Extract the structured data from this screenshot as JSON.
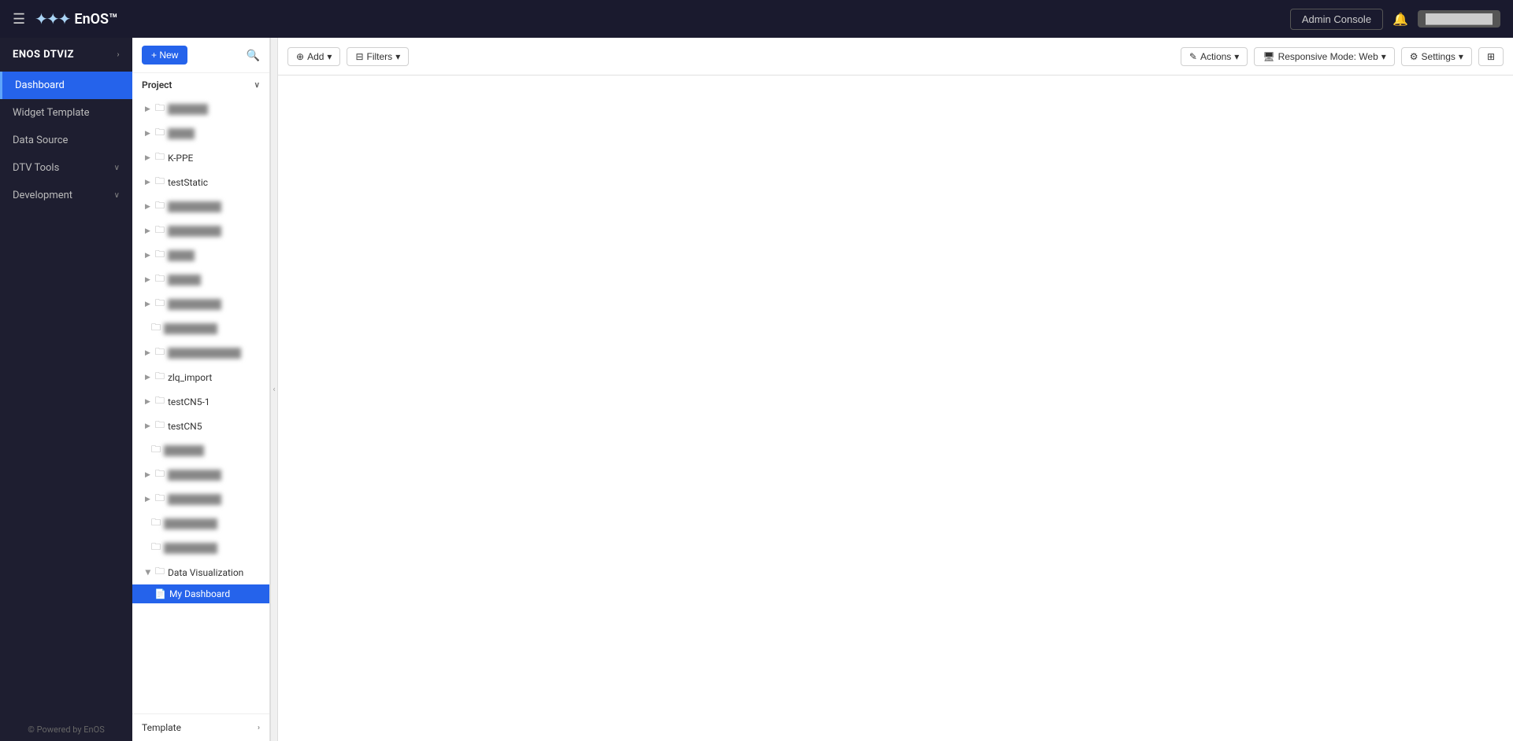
{
  "topnav": {
    "hamburger_icon": "☰",
    "logo_dots": "···",
    "logo_text": "EnOS™",
    "admin_console_label": "Admin Console",
    "notification_icon": "🔔",
    "user_label": "██████████"
  },
  "sidebar": {
    "brand_label": "ENOS DTVIZ",
    "items": [
      {
        "id": "dashboard",
        "label": "Dashboard",
        "active": true,
        "has_chevron": false
      },
      {
        "id": "widget-template",
        "label": "Widget Template",
        "active": false,
        "has_chevron": false
      },
      {
        "id": "data-source",
        "label": "Data Source",
        "active": false,
        "has_chevron": false
      },
      {
        "id": "dtv-tools",
        "label": "DTV Tools",
        "active": false,
        "has_chevron": true
      },
      {
        "id": "development",
        "label": "Development",
        "active": false,
        "has_chevron": true
      }
    ],
    "powered_by": "© Powered by EnOS"
  },
  "tree": {
    "new_btn_label": "+ New",
    "section_label": "Project",
    "items": [
      {
        "id": "item-1",
        "label": "██████",
        "expandable": true,
        "blurred": true,
        "indent": 0
      },
      {
        "id": "item-2",
        "label": "████",
        "expandable": true,
        "blurred": true,
        "indent": 0
      },
      {
        "id": "item-kppe",
        "label": "K-PPE",
        "expandable": true,
        "blurred": false,
        "indent": 0
      },
      {
        "id": "item-teststatic",
        "label": "testStatic",
        "expandable": true,
        "blurred": false,
        "indent": 0
      },
      {
        "id": "item-5",
        "label": "████████",
        "expandable": true,
        "blurred": true,
        "indent": 0
      },
      {
        "id": "item-6",
        "label": "████████",
        "expandable": true,
        "blurred": true,
        "indent": 0
      },
      {
        "id": "item-7",
        "label": "████",
        "expandable": true,
        "blurred": true,
        "indent": 0
      },
      {
        "id": "item-8",
        "label": "█████",
        "expandable": true,
        "blurred": true,
        "indent": 0
      },
      {
        "id": "item-9",
        "label": "████████",
        "expandable": true,
        "blurred": true,
        "indent": 0
      },
      {
        "id": "item-10",
        "label": "████████",
        "expandable": false,
        "blurred": true,
        "indent": 0
      },
      {
        "id": "item-11",
        "label": "███████████",
        "expandable": true,
        "blurred": true,
        "indent": 0
      },
      {
        "id": "item-zlq",
        "label": "zlq_import",
        "expandable": true,
        "blurred": false,
        "indent": 0
      },
      {
        "id": "item-testcn51",
        "label": "testCN5-1",
        "expandable": true,
        "blurred": false,
        "indent": 0
      },
      {
        "id": "item-testcn5",
        "label": "testCN5",
        "expandable": true,
        "blurred": false,
        "indent": 0
      },
      {
        "id": "item-12",
        "label": "██████",
        "expandable": false,
        "blurred": true,
        "indent": 0
      },
      {
        "id": "item-13",
        "label": "████████",
        "expandable": true,
        "blurred": true,
        "indent": 0
      },
      {
        "id": "item-14",
        "label": "████████",
        "expandable": true,
        "blurred": true,
        "indent": 0
      },
      {
        "id": "item-15",
        "label": "████████",
        "expandable": false,
        "blurred": true,
        "indent": 0
      },
      {
        "id": "item-16",
        "label": "████████",
        "expandable": false,
        "blurred": true,
        "indent": 0
      },
      {
        "id": "item-datavis",
        "label": "Data Visualization",
        "expandable": true,
        "expanded": true,
        "blurred": false,
        "indent": 0
      },
      {
        "id": "item-mydash",
        "label": "My Dashboard",
        "expandable": false,
        "blurred": false,
        "indent": 1,
        "active": true,
        "is_file": true
      }
    ],
    "footer_label": "Template"
  },
  "toolbar": {
    "add_label": "Add",
    "filters_label": "Filters",
    "actions_label": "Actions",
    "responsive_mode_label": "Responsive Mode: Web",
    "settings_label": "Settings",
    "layout_icon": "⊞"
  }
}
